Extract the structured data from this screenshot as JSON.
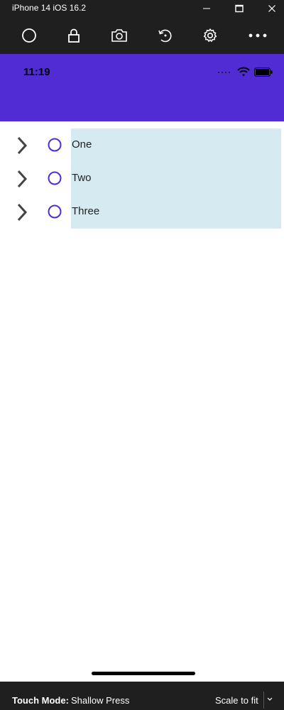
{
  "window": {
    "title": "iPhone 14 iOS 16.2",
    "controls": [
      "minimize-icon",
      "maximize-icon",
      "close-icon"
    ]
  },
  "toolbar": {
    "tools": [
      "home-icon",
      "lock-icon",
      "camera-icon",
      "rotate-icon",
      "gear-icon",
      "more-icon"
    ]
  },
  "device": {
    "status_time": "11:19",
    "accent_color": "#512bd4",
    "tree_items": [
      {
        "label": "One"
      },
      {
        "label": "Two"
      },
      {
        "label": "Three"
      }
    ]
  },
  "bottom": {
    "touch_mode_label": "Touch Mode:",
    "touch_mode_value": "Shallow Press",
    "scale_label": "Scale to fit"
  }
}
